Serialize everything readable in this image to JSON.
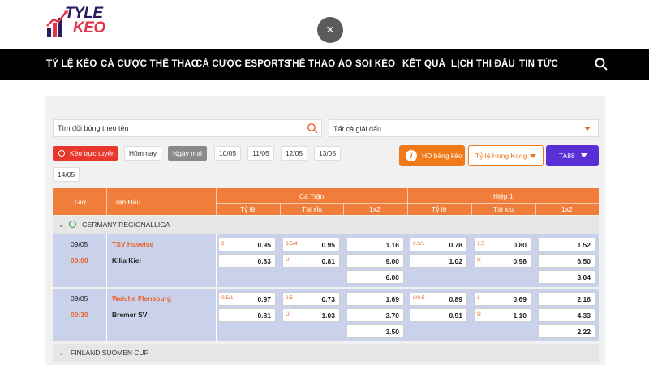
{
  "logo": {
    "line1": "TYLE",
    "line2": "KEO"
  },
  "nav": {
    "items": [
      "TỶ LỆ KÈO",
      "CÁ CƯỢC THỂ THAO",
      "CÁ CƯỢC ESPORTS",
      "THỂ THAO ẢO",
      "SOI KÈO",
      "KẾT QUẢ",
      "LỊCH THI ĐẤU",
      "TIN TỨC"
    ]
  },
  "close_icon": "×",
  "filters": {
    "search_placeholder": "Tìm đội bóng theo tên",
    "league_select": "Tất cả giải đấu",
    "live_label": "Kèo trực tuyến",
    "today_label": "Hôm nay",
    "tomorrow_label": "Ngày mai",
    "dates": [
      "10/05",
      "11/05",
      "12/05",
      "13/05",
      "14/05"
    ],
    "hd_button": "HD bảng kèo",
    "odds_select": "Tỷ lệ Hong Kong",
    "bookmaker": "TA88"
  },
  "table": {
    "col_time": "Giờ",
    "col_match": "Trận Đấu",
    "group_full": "Cả Trận",
    "group_half": "Hiệp 1",
    "sub": [
      "Tỷ lệ",
      "Tài xỉu",
      "1x2",
      "Tỷ lệ",
      "Tài xỉu",
      "1x2"
    ]
  },
  "leagues": [
    {
      "name": "GERMANY REGIONALLIGA",
      "matches": [
        {
          "date": "09/05",
          "time": "00:00",
          "home": "TSV Havelse",
          "away": "Kilia Kiel",
          "ft_hdp": {
            "line": "2",
            "home": "0.95",
            "away": "0.83"
          },
          "ft_ou": {
            "line": "3.5/4",
            "over": "0.95",
            "under_label": "U",
            "under": "0.81"
          },
          "ft_1x2": [
            "1.16",
            "9.00",
            "6.00"
          ],
          "h1_hdp": {
            "line": "0.5/1",
            "home": "0.78",
            "away": "1.02"
          },
          "h1_ou": {
            "line": "1.5",
            "over": "0.80",
            "under_label": "U",
            "under": "0.98"
          },
          "h1_1x2": [
            "1.52",
            "6.50",
            "3.04"
          ]
        },
        {
          "date": "09/05",
          "time": "00:30",
          "home": "Weiche Flensburg",
          "away": "Bremer SV",
          "ft_hdp": {
            "line": "0.5/1",
            "home": "0.97",
            "away": "0.81"
          },
          "ft_ou": {
            "line": "2.5",
            "over": "0.73",
            "under_label": "U",
            "under": "1.03"
          },
          "ft_1x2": [
            "1.69",
            "3.70",
            "3.50"
          ],
          "h1_hdp": {
            "line": "0/0.5",
            "home": "0.89",
            "away": "0.91"
          },
          "h1_ou": {
            "line": "1",
            "over": "0.69",
            "under_label": "U",
            "under": "1.10"
          },
          "h1_1x2": [
            "2.16",
            "4.33",
            "2.22"
          ]
        }
      ]
    },
    {
      "name": "FINLAND SUOMEN CUP",
      "matches": []
    }
  ]
}
